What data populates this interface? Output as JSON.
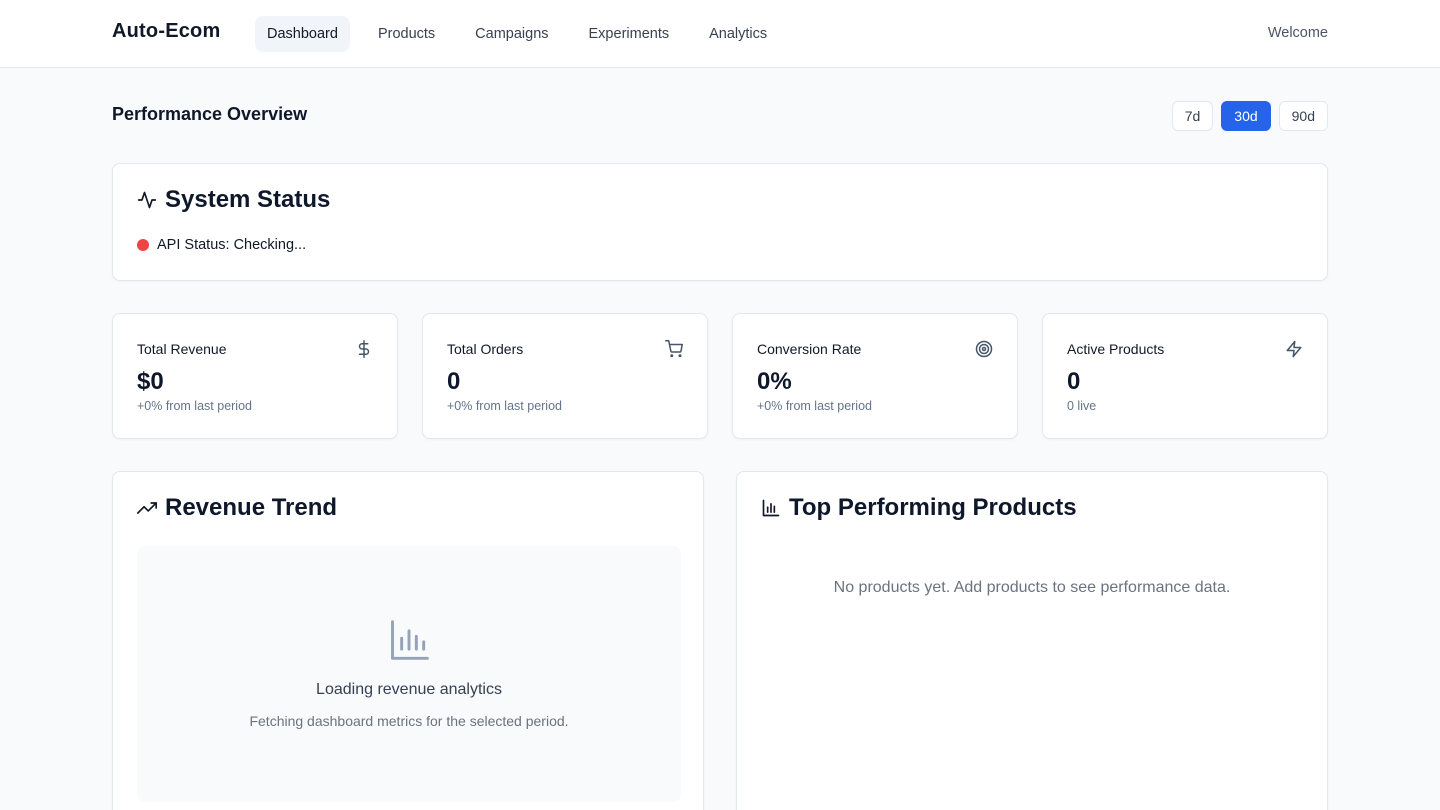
{
  "header": {
    "brand": "Auto-Ecom",
    "nav": [
      "Dashboard",
      "Products",
      "Campaigns",
      "Experiments",
      "Analytics"
    ],
    "active_nav": "Dashboard",
    "welcome": "Welcome"
  },
  "overview": {
    "title": "Performance Overview",
    "periods": [
      "7d",
      "30d",
      "90d"
    ],
    "selected_period": "30d"
  },
  "system_status": {
    "title": "System Status",
    "icon": "activity-icon",
    "api_status": "API Status: Checking...",
    "status_color": "#ef4444"
  },
  "metrics": [
    {
      "label": "Total Revenue",
      "value": "$0",
      "sub": "+0% from last period",
      "icon": "dollar-icon"
    },
    {
      "label": "Total Orders",
      "value": "0",
      "sub": "+0% from last period",
      "icon": "cart-icon"
    },
    {
      "label": "Conversion Rate",
      "value": "0%",
      "sub": "+0% from last period",
      "icon": "target-icon"
    },
    {
      "label": "Active Products",
      "value": "0",
      "sub": "0 live",
      "icon": "zap-icon"
    }
  ],
  "revenue_trend": {
    "title": "Revenue Trend",
    "icon": "trending-up-icon",
    "placeholder_title": "Loading revenue analytics",
    "placeholder_sub": "Fetching dashboard metrics for the selected period."
  },
  "top_products": {
    "title": "Top Performing Products",
    "icon": "bar-chart-icon",
    "empty": "No products yet. Add products to see performance data."
  },
  "colors": {
    "accent": "#2563eb",
    "status_red": "#ef4444"
  }
}
